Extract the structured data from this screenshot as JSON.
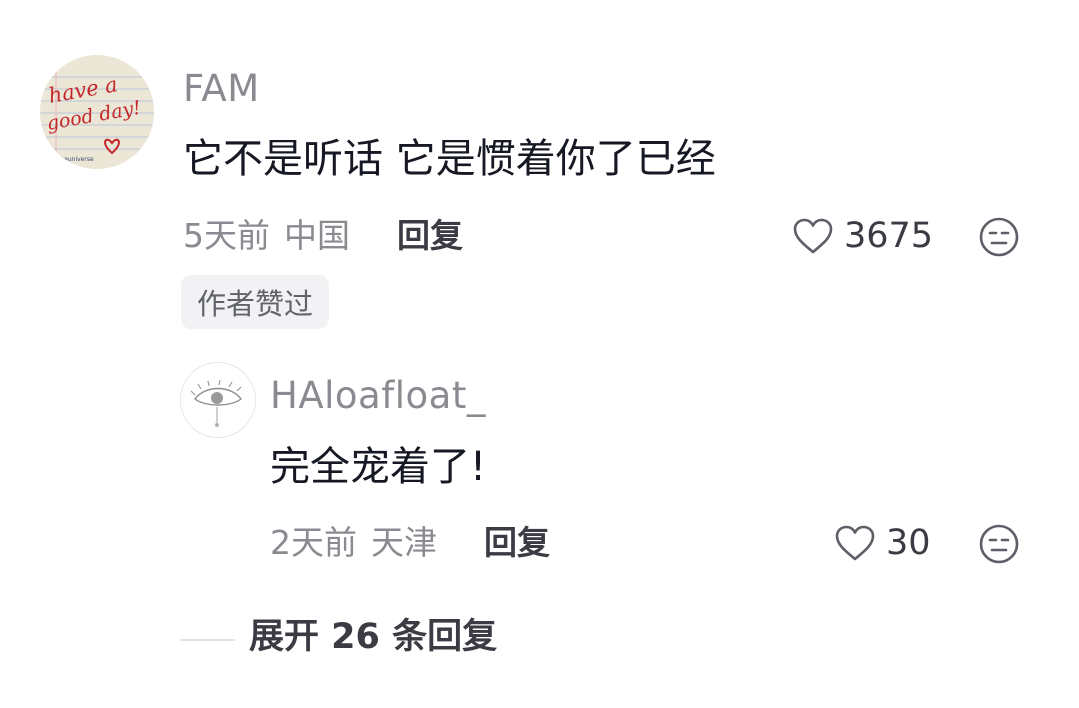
{
  "main_comment": {
    "avatar": {
      "handwriting_line1": "have a",
      "handwriting_line2": "good day!",
      "tiny_text": "theuniverse"
    },
    "username": "FAM",
    "text": "它不是听话 它是惯着你了已经",
    "time": "5天前",
    "location": "中国",
    "reply_label": "回复",
    "like_count": "3675",
    "author_liked_badge": "作者赞过"
  },
  "reply_comment": {
    "username": "HAloafloat_",
    "text": "完全宠着了!",
    "time": "2天前",
    "location": "天津",
    "reply_label": "回复",
    "like_count": "30"
  },
  "expand": {
    "label": "展开 26 条回复"
  },
  "icons": {
    "like": "heart-outline-icon",
    "dislike": "unamused-face-icon"
  },
  "colors": {
    "text_primary": "#161823",
    "text_secondary": "#8a8b91",
    "heart_accent": "#d7262e"
  }
}
